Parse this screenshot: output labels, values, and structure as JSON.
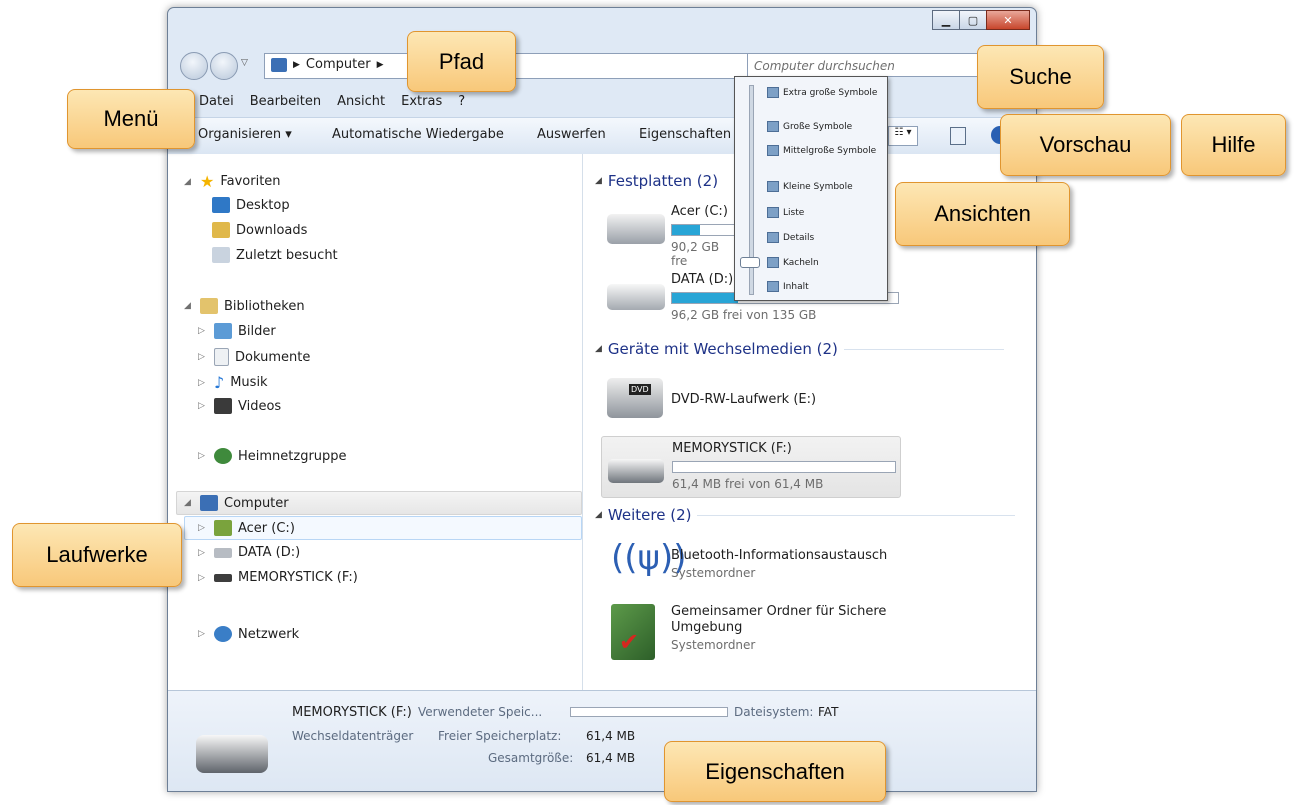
{
  "nav": {
    "breadcrumb": [
      "Computer"
    ],
    "search_placeholder": "Computer durchsuchen"
  },
  "menu": [
    "Datei",
    "Bearbeiten",
    "Ansicht",
    "Extras",
    "?"
  ],
  "toolbar": {
    "organize": "Organisieren",
    "autoplay": "Automatische Wiedergabe",
    "eject": "Auswerfen",
    "properties": "Eigenschaften"
  },
  "tree": {
    "favorites": "Favoriten",
    "desktop": "Desktop",
    "downloads": "Downloads",
    "recent": "Zuletzt besucht",
    "libraries": "Bibliotheken",
    "pictures": "Bilder",
    "documents": "Dokumente",
    "music": "Musik",
    "videos": "Videos",
    "homegroup": "Heimnetzgruppe",
    "computer": "Computer",
    "drive_c": "Acer (C:)",
    "drive_d": "DATA (D:)",
    "drive_f": "MEMORYSTICK (F:)",
    "network": "Netzwerk"
  },
  "main": {
    "hdd_header": "Festplatten (2)",
    "drive_c_name": "Acer (C:)",
    "drive_c_free": "90,2 GB fre",
    "drive_c_fill": 0.42,
    "drive_d_name": "DATA (D:)",
    "drive_d_free": "96,2 GB frei von 135 GB",
    "drive_d_fill": 0.29,
    "removable_header": "Geräte mit Wechselmedien (2)",
    "dvd_name": "DVD-RW-Laufwerk (E:)",
    "dvd_badge": "DVD",
    "stick_name": "MEMORYSTICK (F:)",
    "stick_free": "61,4 MB frei von 61,4 MB",
    "stick_fill": 0,
    "other_header": "Weitere (2)",
    "bt_name": "Bluetooth-Informationsaustausch",
    "bt_type": "Systemordner",
    "share_name_1": "Gemeinsamer Ordner für Sichere",
    "share_name_2": "Umgebung",
    "share_type": "Systemordner"
  },
  "view_menu": [
    "Extra große Symbole",
    "Große Symbole",
    "Mittelgroße Symbole",
    "Kleine Symbole",
    "Liste",
    "Details",
    "Kacheln",
    "Inhalt"
  ],
  "details": {
    "name": "MEMORYSTICK (F:)",
    "type": "Wechseldatenträger",
    "used_label": "Verwendeter Speic...",
    "fs_label": "Dateisystem:",
    "fs_value": "FAT",
    "free_label": "Freier Speicherplatz:",
    "free_value": "61,4 MB",
    "total_label": "Gesamtgröße:",
    "total_value": "61,4 MB"
  },
  "callouts": {
    "path": "Pfad",
    "search": "Suche",
    "menu": "Menü",
    "preview": "Vorschau",
    "help": "Hilfe",
    "views": "Ansichten",
    "drives": "Laufwerke",
    "properties": "Eigenschaften"
  },
  "colors": {
    "accent": "#1e3287",
    "bar_fill": "#28a5d6",
    "callout": "#f8c87a"
  }
}
